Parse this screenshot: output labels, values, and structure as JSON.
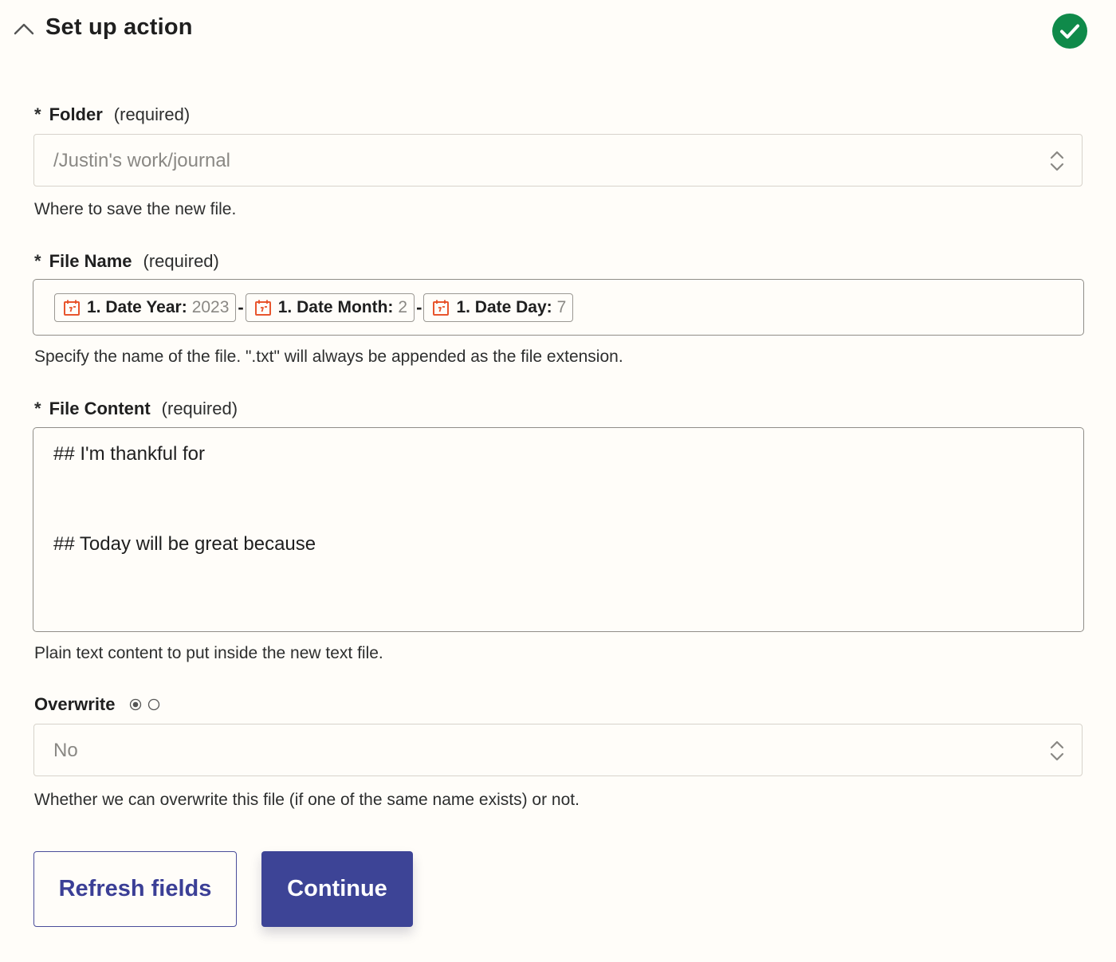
{
  "header": {
    "title": "Set up action",
    "status": "complete"
  },
  "folder": {
    "asterisk": "*",
    "label": "Folder",
    "required": "(required)",
    "value": "/Justin's work/journal",
    "help": "Where to save the new file."
  },
  "file_name": {
    "asterisk": "*",
    "label": "File Name",
    "required": "(required)",
    "pills": [
      {
        "key": "1. Date Year:",
        "value": "2023",
        "icon": "calendar-icon"
      },
      {
        "key": "1. Date Month:",
        "value": "2",
        "icon": "calendar-icon"
      },
      {
        "key": "1. Date Day:",
        "value": "7",
        "icon": "calendar-icon"
      }
    ],
    "separator": "-",
    "help": "Specify the name of the file. \".txt\" will always be appended as the file extension."
  },
  "file_content": {
    "asterisk": "*",
    "label": "File Content",
    "required": "(required)",
    "lines": [
      "## I'm thankful for",
      "## Today will be great because"
    ],
    "help": "Plain text content to put inside the new text file."
  },
  "overwrite": {
    "label": "Overwrite",
    "value": "No",
    "help": "Whether we can overwrite this file (if one of the same name exists) or not."
  },
  "buttons": {
    "refresh": "Refresh fields",
    "continue": "Continue"
  },
  "colors": {
    "background": "#fffdf9",
    "success": "#0f8a4a",
    "accent": "#3d4496",
    "pill_icon": "#e8552d"
  }
}
